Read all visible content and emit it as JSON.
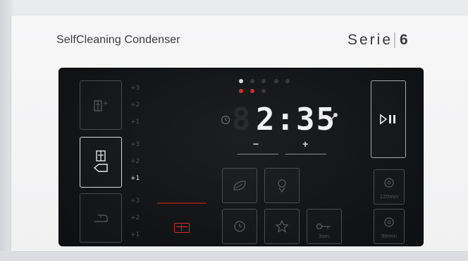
{
  "header": {
    "model_name": "SelfCleaning Condenser",
    "series_prefix": "Serie",
    "series_number": "6"
  },
  "display": {
    "remaining_time": "2:35",
    "ghost_digit": "8",
    "minus_label": "−",
    "plus_label": "+"
  },
  "left_column": {
    "group1_options": [
      "+3",
      "+2",
      "+1"
    ],
    "group2_options": [
      "+3",
      "+2",
      "+1"
    ],
    "group3_options": [
      "+3",
      "+2",
      "+1"
    ],
    "selected_option": "+1"
  },
  "right_column": {
    "timer_120_label": "120min",
    "timer_90_label": "90min"
  },
  "buttons": {
    "sec_label": "3sec"
  },
  "colors": {
    "panel": "#121315",
    "active_white": "#f2f2f4",
    "indicator_red": "#c8312a",
    "inactive_grey": "#4a4c50"
  }
}
